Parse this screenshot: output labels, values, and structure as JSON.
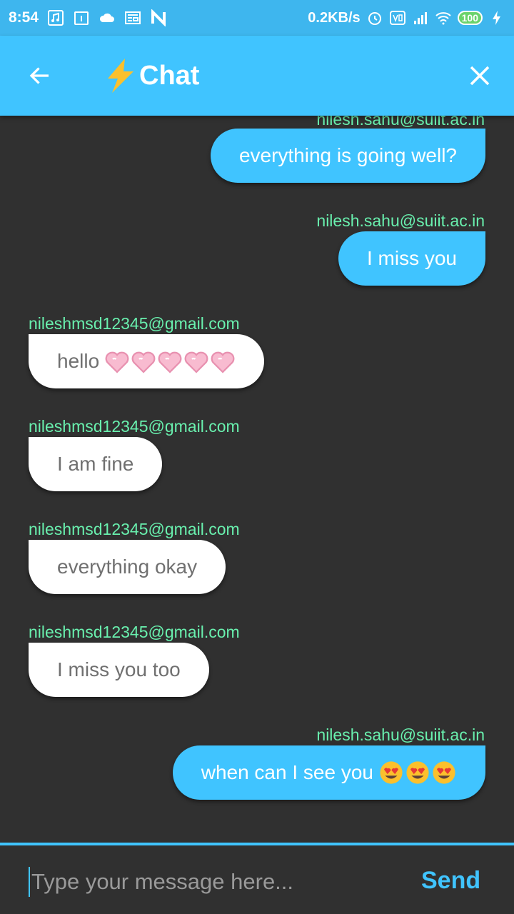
{
  "status_bar": {
    "time": "8:54",
    "net_speed": "0.2KB/s",
    "battery": "100"
  },
  "app_bar": {
    "title": "Chat",
    "bolt_icon": "lightning-bolt-icon",
    "back_icon": "arrow-back-icon",
    "close_icon": "close-icon"
  },
  "messages": [
    {
      "sender": "nilesh.sahu@suiit.ac.in",
      "text": "everything is going well?",
      "from_me": true
    },
    {
      "sender": "nilesh.sahu@suiit.ac.in",
      "text": "I miss you",
      "from_me": true
    },
    {
      "sender": "nileshmsd12345@gmail.com",
      "text": "hello",
      "from_me": false,
      "emoji": "heart-icon x5"
    },
    {
      "sender": "nileshmsd12345@gmail.com",
      "text": "I am fine",
      "from_me": false
    },
    {
      "sender": "nileshmsd12345@gmail.com",
      "text": "everything okay",
      "from_me": false
    },
    {
      "sender": "nileshmsd12345@gmail.com",
      "text": "I miss you too",
      "from_me": false
    },
    {
      "sender": "nilesh.sahu@suiit.ac.in",
      "text": "when can I see you",
      "from_me": true,
      "emoji": "heart-eyes-face-icon x3"
    }
  ],
  "input": {
    "placeholder": "Type your message here...",
    "send_label": "Send"
  },
  "colors": {
    "accent": "#40c4ff",
    "sender_text": "#69f0ae",
    "background": "#303030"
  }
}
